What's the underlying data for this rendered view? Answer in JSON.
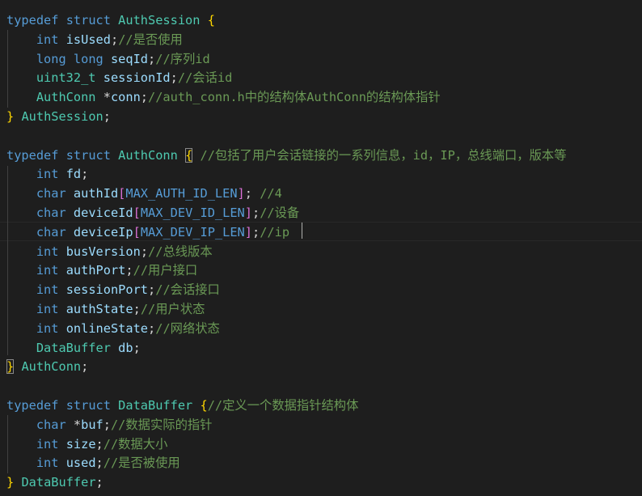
{
  "editor": {
    "colors": {
      "background": "#1e1e1e",
      "keyword": "#569cd6",
      "type": "#4ec9b0",
      "variable": "#9cdcfe",
      "comment": "#6a9955",
      "punctuation": "#d4d4d4",
      "bracket_level1": "#ffd700",
      "bracket_level2": "#da70d6"
    },
    "lines": [
      [
        {
          "t": "typedef",
          "c": "kw"
        },
        {
          "t": " ",
          "c": "p"
        },
        {
          "t": "struct",
          "c": "kw"
        },
        {
          "t": " ",
          "c": "p"
        },
        {
          "t": "AuthSession",
          "c": "type"
        },
        {
          "t": " ",
          "c": "p"
        },
        {
          "t": "{",
          "c": "b1"
        }
      ],
      [
        {
          "t": "    ",
          "c": "p"
        },
        {
          "t": "int",
          "c": "kw"
        },
        {
          "t": " ",
          "c": "p"
        },
        {
          "t": "isUsed",
          "c": "var"
        },
        {
          "t": ";",
          "c": "p"
        },
        {
          "t": "//是否使用",
          "c": "cmt"
        }
      ],
      [
        {
          "t": "    ",
          "c": "p"
        },
        {
          "t": "long",
          "c": "kw"
        },
        {
          "t": " ",
          "c": "p"
        },
        {
          "t": "long",
          "c": "kw"
        },
        {
          "t": " ",
          "c": "p"
        },
        {
          "t": "seqId",
          "c": "var"
        },
        {
          "t": ";",
          "c": "p"
        },
        {
          "t": "//序列id",
          "c": "cmt"
        }
      ],
      [
        {
          "t": "    ",
          "c": "p"
        },
        {
          "t": "uint32_t",
          "c": "type"
        },
        {
          "t": " ",
          "c": "p"
        },
        {
          "t": "sessionId",
          "c": "var"
        },
        {
          "t": ";",
          "c": "p"
        },
        {
          "t": "//会话id",
          "c": "cmt"
        }
      ],
      [
        {
          "t": "    ",
          "c": "p"
        },
        {
          "t": "AuthConn",
          "c": "type"
        },
        {
          "t": " *",
          "c": "p"
        },
        {
          "t": "conn",
          "c": "var"
        },
        {
          "t": ";",
          "c": "p"
        },
        {
          "t": "//auth_conn.h中的结构体AuthConn的结构体指针",
          "c": "cmt"
        }
      ],
      [
        {
          "t": "}",
          "c": "b1"
        },
        {
          "t": " ",
          "c": "p"
        },
        {
          "t": "AuthSession",
          "c": "type"
        },
        {
          "t": ";",
          "c": "p"
        }
      ],
      [],
      [
        {
          "t": "typedef",
          "c": "kw"
        },
        {
          "t": " ",
          "c": "p"
        },
        {
          "t": "struct",
          "c": "kw"
        },
        {
          "t": " ",
          "c": "p"
        },
        {
          "t": "AuthConn",
          "c": "type"
        },
        {
          "t": " ",
          "c": "p"
        },
        {
          "t": "{",
          "c": "b1",
          "box": true
        },
        {
          "t": " ",
          "c": "p"
        },
        {
          "t": "//包括了用户会话链接的一系列信息，id，IP，总线端口，版本等",
          "c": "cmt"
        }
      ],
      [
        {
          "t": "    ",
          "c": "p"
        },
        {
          "t": "int",
          "c": "kw"
        },
        {
          "t": " ",
          "c": "p"
        },
        {
          "t": "fd",
          "c": "var"
        },
        {
          "t": ";",
          "c": "p"
        }
      ],
      [
        {
          "t": "    ",
          "c": "p"
        },
        {
          "t": "char",
          "c": "kw"
        },
        {
          "t": " ",
          "c": "p"
        },
        {
          "t": "authId",
          "c": "var"
        },
        {
          "t": "[",
          "c": "b2"
        },
        {
          "t": "MAX_AUTH_ID_LEN",
          "c": "mac"
        },
        {
          "t": "]",
          "c": "b2"
        },
        {
          "t": "; ",
          "c": "p"
        },
        {
          "t": "//4",
          "c": "cmt"
        }
      ],
      [
        {
          "t": "    ",
          "c": "p"
        },
        {
          "t": "char",
          "c": "kw"
        },
        {
          "t": " ",
          "c": "p"
        },
        {
          "t": "deviceId",
          "c": "var"
        },
        {
          "t": "[",
          "c": "b2"
        },
        {
          "t": "MAX_DEV_ID_LEN",
          "c": "mac"
        },
        {
          "t": "]",
          "c": "b2"
        },
        {
          "t": ";",
          "c": "p"
        },
        {
          "t": "//设备",
          "c": "cmt"
        }
      ],
      [
        {
          "t": "    ",
          "c": "p"
        },
        {
          "t": "char",
          "c": "kw"
        },
        {
          "t": " ",
          "c": "p"
        },
        {
          "t": "deviceIp",
          "c": "var"
        },
        {
          "t": "[",
          "c": "b2"
        },
        {
          "t": "MAX_DEV_IP_LEN",
          "c": "mac"
        },
        {
          "t": "]",
          "c": "b2"
        },
        {
          "t": ";",
          "c": "p"
        },
        {
          "t": "//ip",
          "c": "cmt"
        }
      ],
      [
        {
          "t": "    ",
          "c": "p"
        },
        {
          "t": "int",
          "c": "kw"
        },
        {
          "t": " ",
          "c": "p"
        },
        {
          "t": "busVersion",
          "c": "var"
        },
        {
          "t": ";",
          "c": "p"
        },
        {
          "t": "//总线版本",
          "c": "cmt"
        }
      ],
      [
        {
          "t": "    ",
          "c": "p"
        },
        {
          "t": "int",
          "c": "kw"
        },
        {
          "t": " ",
          "c": "p"
        },
        {
          "t": "authPort",
          "c": "var"
        },
        {
          "t": ";",
          "c": "p"
        },
        {
          "t": "//用户接口",
          "c": "cmt"
        }
      ],
      [
        {
          "t": "    ",
          "c": "p"
        },
        {
          "t": "int",
          "c": "kw"
        },
        {
          "t": " ",
          "c": "p"
        },
        {
          "t": "sessionPort",
          "c": "var"
        },
        {
          "t": ";",
          "c": "p"
        },
        {
          "t": "//会话接口",
          "c": "cmt"
        }
      ],
      [
        {
          "t": "    ",
          "c": "p"
        },
        {
          "t": "int",
          "c": "kw"
        },
        {
          "t": " ",
          "c": "p"
        },
        {
          "t": "authState",
          "c": "var"
        },
        {
          "t": ";",
          "c": "p"
        },
        {
          "t": "//用户状态",
          "c": "cmt"
        }
      ],
      [
        {
          "t": "    ",
          "c": "p"
        },
        {
          "t": "int",
          "c": "kw"
        },
        {
          "t": " ",
          "c": "p"
        },
        {
          "t": "onlineState",
          "c": "var"
        },
        {
          "t": ";",
          "c": "p"
        },
        {
          "t": "//网络状态",
          "c": "cmt"
        }
      ],
      [
        {
          "t": "    ",
          "c": "p"
        },
        {
          "t": "DataBuffer",
          "c": "type"
        },
        {
          "t": " ",
          "c": "p"
        },
        {
          "t": "db",
          "c": "var"
        },
        {
          "t": ";",
          "c": "p"
        }
      ],
      [
        {
          "t": "}",
          "c": "b1",
          "box": true
        },
        {
          "t": " ",
          "c": "p"
        },
        {
          "t": "AuthConn",
          "c": "type"
        },
        {
          "t": ";",
          "c": "p"
        }
      ],
      [],
      [
        {
          "t": "typedef",
          "c": "kw"
        },
        {
          "t": " ",
          "c": "p"
        },
        {
          "t": "struct",
          "c": "kw"
        },
        {
          "t": " ",
          "c": "p"
        },
        {
          "t": "DataBuffer",
          "c": "type"
        },
        {
          "t": " ",
          "c": "p"
        },
        {
          "t": "{",
          "c": "b1"
        },
        {
          "t": "//定义一个数据指针结构体",
          "c": "cmt"
        }
      ],
      [
        {
          "t": "    ",
          "c": "p"
        },
        {
          "t": "char",
          "c": "kw"
        },
        {
          "t": " *",
          "c": "p"
        },
        {
          "t": "buf",
          "c": "var"
        },
        {
          "t": ";",
          "c": "p"
        },
        {
          "t": "//数据实际的指针",
          "c": "cmt"
        }
      ],
      [
        {
          "t": "    ",
          "c": "p"
        },
        {
          "t": "int",
          "c": "kw"
        },
        {
          "t": " ",
          "c": "p"
        },
        {
          "t": "size",
          "c": "var"
        },
        {
          "t": ";",
          "c": "p"
        },
        {
          "t": "//数据大小",
          "c": "cmt"
        }
      ],
      [
        {
          "t": "    ",
          "c": "p"
        },
        {
          "t": "int",
          "c": "kw"
        },
        {
          "t": " ",
          "c": "p"
        },
        {
          "t": "used",
          "c": "var"
        },
        {
          "t": ";",
          "c": "p"
        },
        {
          "t": "//是否被使用",
          "c": "cmt"
        }
      ],
      [
        {
          "t": "}",
          "c": "b1"
        },
        {
          "t": " ",
          "c": "p"
        },
        {
          "t": "DataBuffer",
          "c": "type"
        },
        {
          "t": ";",
          "c": "p"
        }
      ]
    ]
  }
}
